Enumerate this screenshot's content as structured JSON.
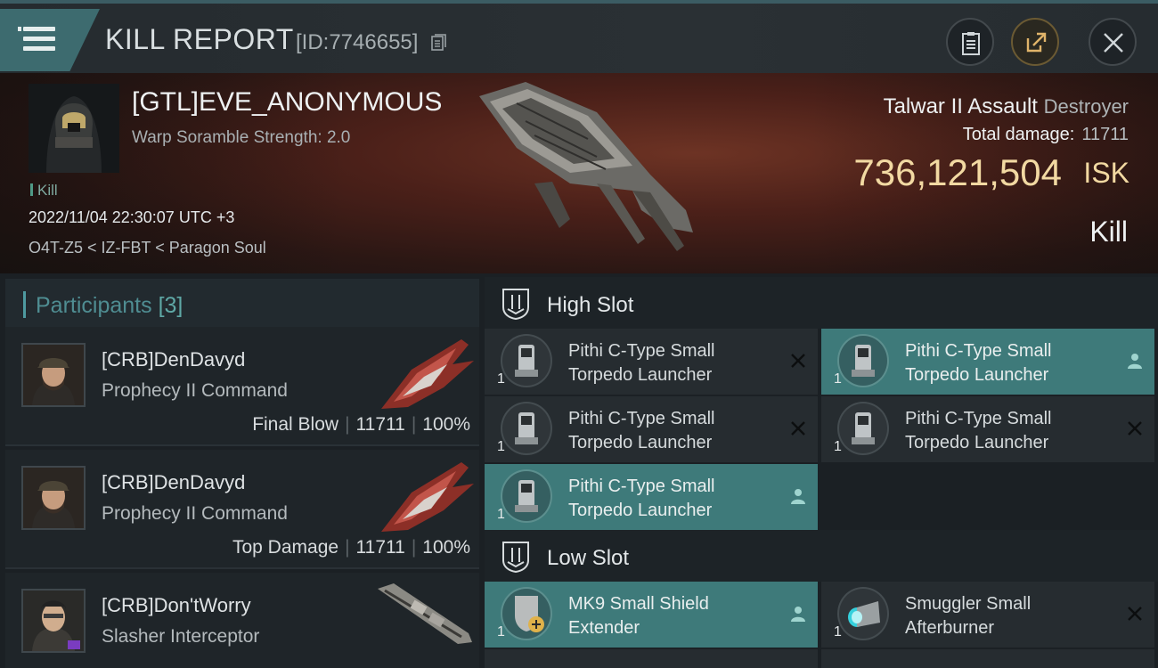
{
  "header": {
    "title": "KILL REPORT",
    "report_id": "[ID:7746655]",
    "icons": {
      "menu": "menu-icon",
      "copy": "copy-icon",
      "clipboard": "clipboard-icon",
      "share": "share-icon",
      "close": "close-icon"
    }
  },
  "victim": {
    "name": "[GTL]EVE_ANONYMOUS",
    "warp_scramble": "Warp Soramble Strength: 2.0",
    "tag": "Kill",
    "datetime": "2022/11/04 22:30:07 UTC +3",
    "location": "O4T-Z5 < IZ-FBT < Paragon Soul",
    "ship_name": "Talwar II Assault",
    "ship_class": "Destroyer",
    "total_damage_label": "Total damage:",
    "total_damage": "11711",
    "isk_value": "736,121,504",
    "isk_unit": "ISK",
    "result": "Kill"
  },
  "participants": {
    "label": "Participants",
    "count": "[3]",
    "rows": [
      {
        "name": "[CRB]DenDavyd",
        "ship": "Prophecy II Command",
        "role": "Final Blow",
        "damage": "11711",
        "percent": "100%"
      },
      {
        "name": "[CRB]DenDavyd",
        "ship": "Prophecy II Command",
        "role": "Top Damage",
        "damage": "11711",
        "percent": "100%"
      },
      {
        "name": "[CRB]Don'tWorry",
        "ship": "Slasher Interceptor",
        "role": "",
        "damage": "",
        "percent": ""
      }
    ]
  },
  "fittings": {
    "high_slot": {
      "label": "High Slot",
      "modules": [
        {
          "name": "Pithi C-Type Small Torpedo Launcher",
          "qty": "1",
          "status": "destroyed"
        },
        {
          "name": "Pithi C-Type Small Torpedo Launcher",
          "qty": "1",
          "status": "dropped"
        },
        {
          "name": "Pithi C-Type Small Torpedo Launcher",
          "qty": "1",
          "status": "destroyed"
        },
        {
          "name": "Pithi C-Type Small Torpedo Launcher",
          "qty": "1",
          "status": "destroyed"
        },
        {
          "name": "Pithi C-Type Small Torpedo Launcher",
          "qty": "1",
          "status": "dropped"
        }
      ]
    },
    "low_slot": {
      "label": "Low Slot",
      "modules": [
        {
          "name": "MK9 Small Shield Extender",
          "qty": "1",
          "status": "dropped"
        },
        {
          "name": "Smuggler Small Afterburner",
          "qty": "1",
          "status": "destroyed"
        }
      ]
    }
  },
  "colors": {
    "accent": "#3e7a7a",
    "isk": "#f2d9a2",
    "teal_text": "#4f8d92"
  }
}
